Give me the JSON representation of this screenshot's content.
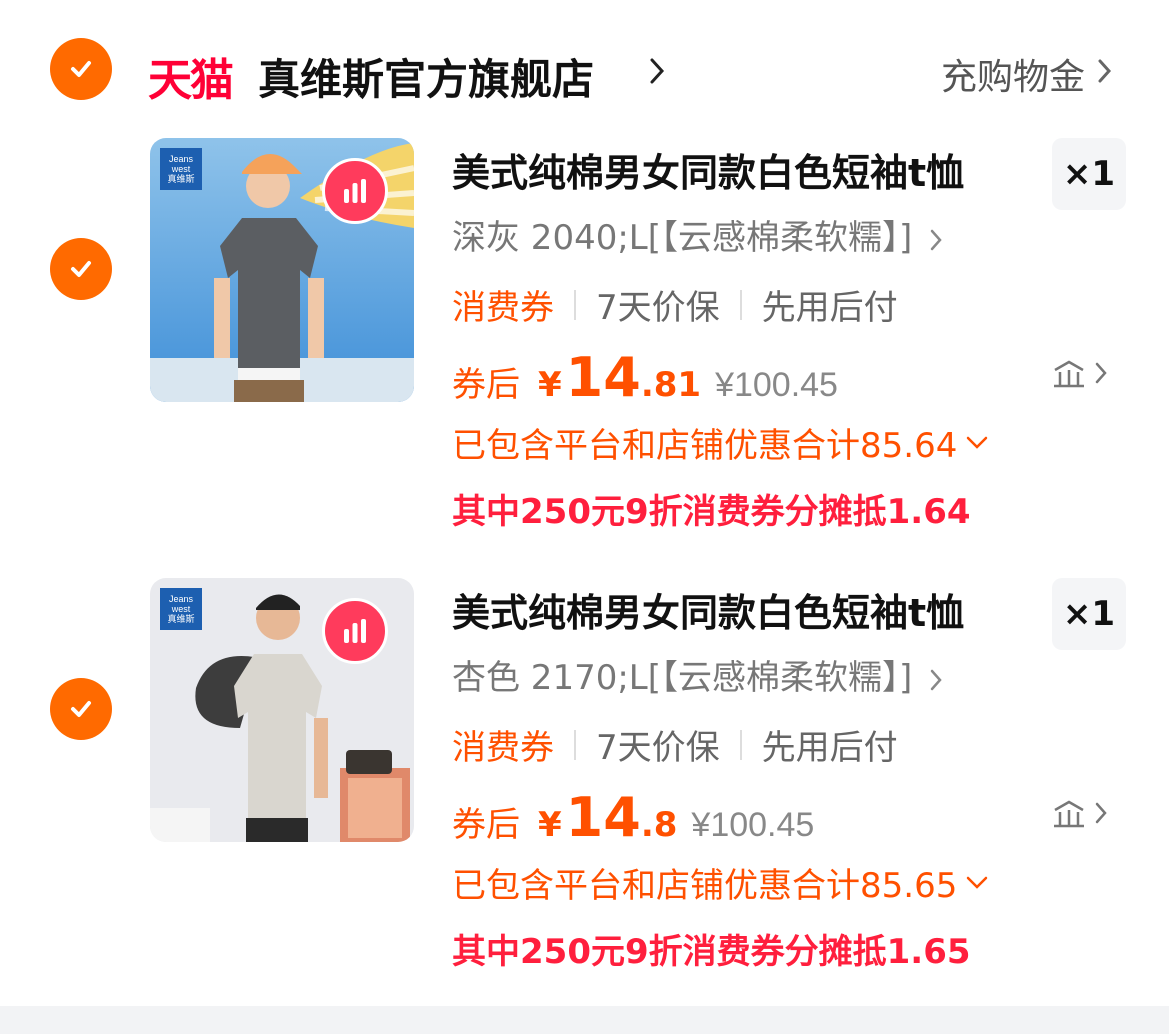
{
  "shop": {
    "platform": "天猫",
    "name": "真维斯官方旗舰店",
    "recharge_label": "充购物金"
  },
  "colors": {
    "accent": "#ff5000",
    "check": "#ff6a00",
    "tmall": "#ff0036",
    "coupon_red": "#ff1f3d"
  },
  "items": [
    {
      "title": "美式纯棉男女同款白色短袖t恤",
      "quantity": "×1",
      "sku": "深灰 2040;L[【云感棉柔软糯】]",
      "tags": [
        "消费券",
        "7天价保",
        "先用后付"
      ],
      "price_label": "券后",
      "currency": "¥",
      "price_int": "14",
      "price_dec": ".81",
      "original_price": "¥100.45",
      "discount_text": "已包含平台和店铺优惠合计85.64",
      "coupon_text": "其中250元9折消费券分摊抵1.64",
      "brand_badge": [
        "Jeans",
        "west",
        "真维斯"
      ],
      "shirt_color": "#5b5e62"
    },
    {
      "title": "美式纯棉男女同款白色短袖t恤",
      "quantity": "×1",
      "sku": "杏色 2170;L[【云感棉柔软糯】]",
      "tags": [
        "消费券",
        "7天价保",
        "先用后付"
      ],
      "price_label": "券后",
      "currency": "¥",
      "price_int": "14",
      "price_dec": ".8",
      "original_price": "¥100.45",
      "discount_text": "已包含平台和店铺优惠合计85.65",
      "coupon_text": "其中250元9折消费券分摊抵1.65",
      "brand_badge": [
        "Jeans",
        "west",
        "真维斯"
      ],
      "shirt_color": "#d9d6cf"
    }
  ]
}
